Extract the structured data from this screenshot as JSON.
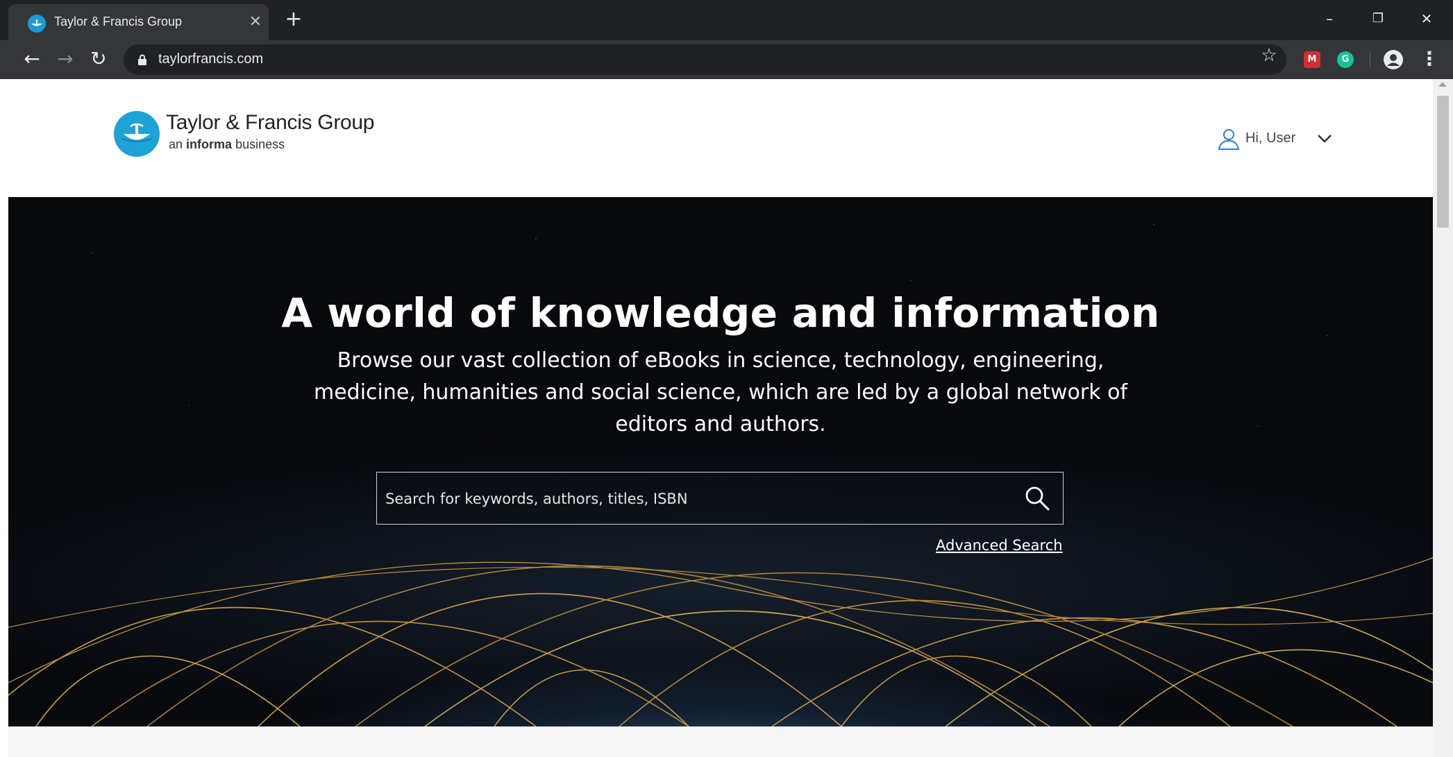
{
  "browser": {
    "tab": {
      "title": "Taylor & Francis Group",
      "close_glyph": "✕"
    },
    "new_tab_glyph": "+",
    "window_controls": {
      "minimize": "–",
      "restore": "❐",
      "close": "✕"
    },
    "nav": {
      "back": "←",
      "forward": "→",
      "reload": "↻"
    },
    "url": "taylorfrancis.com",
    "bookmark_glyph": "☆",
    "extensions": [
      {
        "name": "mendeley-extension-icon",
        "glyph": "M",
        "color": "#d32f2f"
      },
      {
        "name": "grammarly-extension-icon",
        "glyph": "G",
        "color": "#15c39a"
      }
    ],
    "menu_glyph": "⋮"
  },
  "header": {
    "logo_title": "Taylor & Francis Group",
    "logo_sub_prefix": "an",
    "logo_sub_bold": "informa",
    "logo_sub_suffix": "business",
    "user_label": "Hi, User"
  },
  "hero": {
    "title": "A world of knowledge and information",
    "subtitle": "Browse our vast collection of eBooks in science, technology, engineering, medicine, humanities and social science, which are led by a global network of editors and authors.",
    "search_placeholder": "Search for keywords, authors, titles, ISBN",
    "advanced_search_label": "Advanced Search"
  },
  "colors": {
    "brand_blue": "#1fa3d6",
    "chrome_dark": "#202124",
    "chrome_toolbar": "#35363a"
  }
}
